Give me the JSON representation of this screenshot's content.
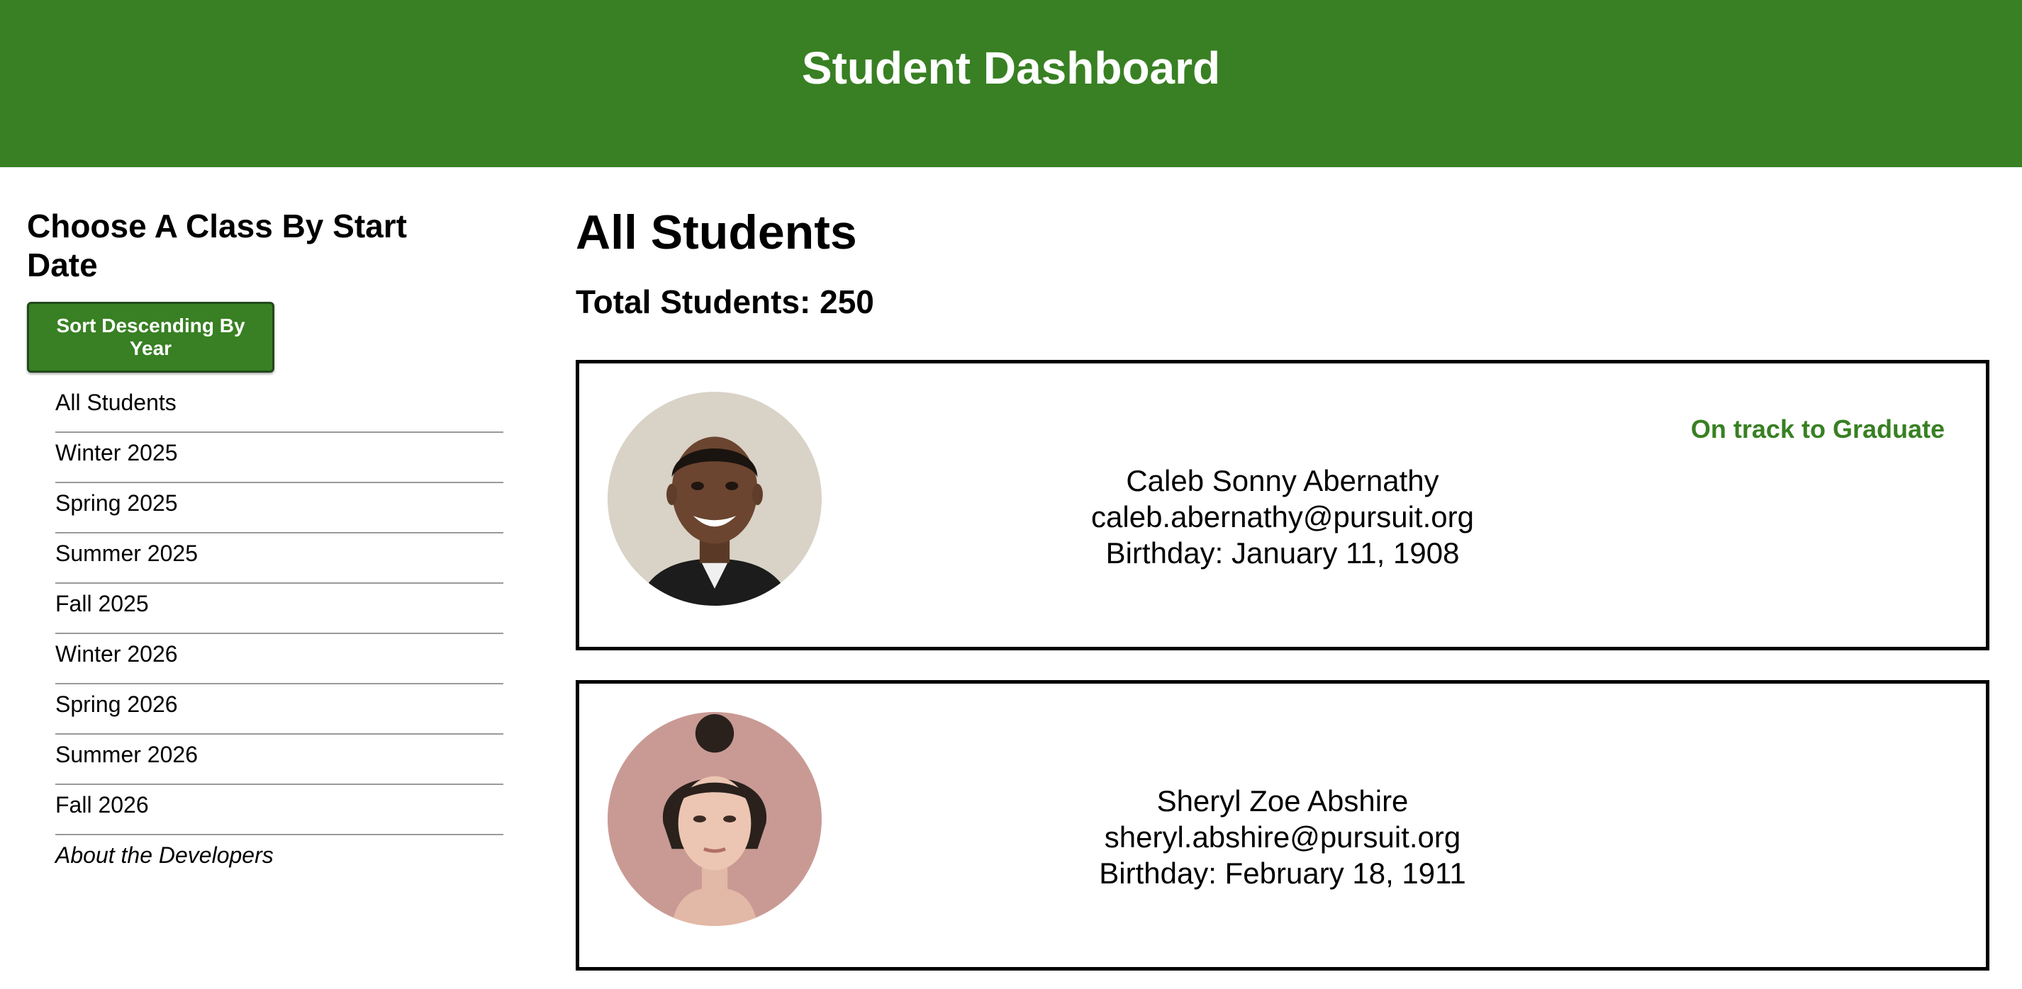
{
  "header": {
    "title": "Student Dashboard"
  },
  "sidebar": {
    "heading": "Choose A Class By Start Date",
    "sort_button": "Sort Descending By Year",
    "items": [
      {
        "label": "All Students"
      },
      {
        "label": "Winter 2025"
      },
      {
        "label": "Spring 2025"
      },
      {
        "label": "Summer 2025"
      },
      {
        "label": "Fall 2025"
      },
      {
        "label": "Winter 2026"
      },
      {
        "label": "Spring 2026"
      },
      {
        "label": "Summer 2026"
      },
      {
        "label": "Fall 2026"
      }
    ],
    "about_link": "About the Developers"
  },
  "main": {
    "title": "All Students",
    "total_label": "Total Students: 250",
    "students": [
      {
        "name": "Caleb Sonny Abernathy",
        "email": "caleb.abernathy@pursuit.org",
        "birthday": "Birthday: January 11, 1908",
        "status": "On track to Graduate",
        "avatar": "student-photo-icon"
      },
      {
        "name": "Sheryl Zoe Abshire",
        "email": "sheryl.abshire@pursuit.org",
        "birthday": "Birthday: February 18, 1911",
        "status": "",
        "avatar": "student-photo-icon"
      }
    ]
  },
  "colors": {
    "brand_green": "#388023",
    "text": "#000000",
    "divider": "#9a9a9a"
  }
}
